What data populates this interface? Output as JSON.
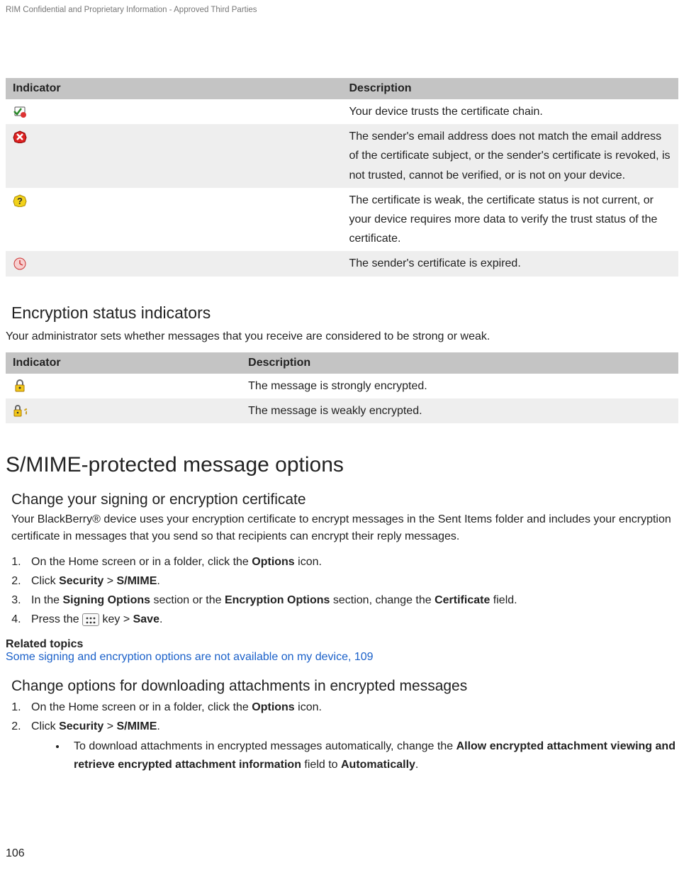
{
  "header": {
    "confidential": "RIM Confidential and Proprietary Information - Approved Third Parties"
  },
  "table1": {
    "head": {
      "col1": "Indicator",
      "col2": "Description"
    },
    "rows": [
      {
        "icon": "cert-trusted-icon",
        "desc": "Your device trusts the certificate chain."
      },
      {
        "icon": "cert-error-icon",
        "desc": "The sender's email address does not match the email address of the certificate subject, or the sender's certificate is revoked, is not trusted, cannot be verified, or is not on your device."
      },
      {
        "icon": "cert-warning-icon",
        "desc": "The certificate is weak, the certificate status is not current, or your device requires more data to verify the trust status of the certificate."
      },
      {
        "icon": "cert-expired-icon",
        "desc": "The sender's certificate is expired."
      }
    ]
  },
  "section1": {
    "title": "Encryption status indicators",
    "intro": "Your administrator sets whether messages that you receive are considered to be strong or weak."
  },
  "table2": {
    "head": {
      "col1": "Indicator",
      "col2": "Description"
    },
    "rows": [
      {
        "icon": "lock-strong-icon",
        "desc": "The message is strongly encrypted."
      },
      {
        "icon": "lock-weak-icon",
        "desc": "The message is weakly encrypted."
      }
    ]
  },
  "section2": {
    "title": "S/MIME-protected message options"
  },
  "sub1": {
    "title": "Change your signing or encryption certificate",
    "intro": "Your BlackBerry® device uses your encryption certificate to encrypt messages in the Sent Items folder and includes your encryption certificate in messages that you send so that recipients can encrypt their reply messages.",
    "steps": {
      "s1_a": "On the Home screen or in a folder, click the ",
      "s1_b": "Options",
      "s1_c": " icon.",
      "s2_a": "Click ",
      "s2_b": "Security",
      "s2_c": " > ",
      "s2_d": "S/MIME",
      "s2_e": ".",
      "s3_a": "In the ",
      "s3_b": "Signing Options",
      "s3_c": " section or the ",
      "s3_d": "Encryption Options",
      "s3_e": " section, change the ",
      "s3_f": "Certificate",
      "s3_g": " field.",
      "s4_a": "Press the ",
      "s4_key": "⠶",
      "s4_b": " key > ",
      "s4_c": "Save",
      "s4_d": "."
    },
    "related_head": "Related topics",
    "related_link": "Some signing and encryption options are not available on my device, 109"
  },
  "sub2": {
    "title": "Change options for downloading attachments in encrypted messages",
    "steps": {
      "s1_a": "On the Home screen or in a folder, click the ",
      "s1_b": "Options",
      "s1_c": " icon.",
      "s2_a": "Click ",
      "s2_b": "Security",
      "s2_c": " > ",
      "s2_d": "S/MIME",
      "s2_e": "."
    },
    "bullet": {
      "a": "To download attachments in encrypted messages automatically, change the ",
      "b": "Allow encrypted attachment viewing and retrieve encrypted attachment information",
      "c": " field to ",
      "d": "Automatically",
      "e": "."
    }
  },
  "footer": {
    "page": "106"
  }
}
